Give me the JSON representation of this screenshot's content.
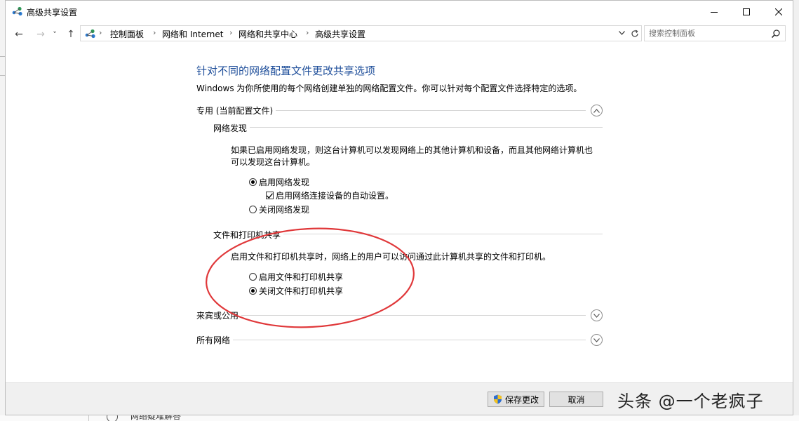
{
  "window": {
    "title": "高级共享设置"
  },
  "nav": {
    "back": "←",
    "forward": "→",
    "recent": "˅",
    "up": "↑"
  },
  "breadcrumb": [
    "控制面板",
    "网络和 Internet",
    "网络和共享中心",
    "高级共享设置"
  ],
  "search": {
    "placeholder": "搜索控制面板"
  },
  "main": {
    "heading": "针对不同的网络配置文件更改共享选项",
    "description": "Windows 为你所使用的每个网络创建单独的网络配置文件。你可以针对每个配置文件选择特定的选项。",
    "profiles": [
      {
        "label": "专用 (当前配置文件)",
        "expanded": true,
        "sections": [
          {
            "title": "网络发现",
            "text_line1": "如果已启用网络发现，则这台计算机可以发现网络上的其他计算机和设备，而且其他网络计算机也",
            "text_line2": "可以发现这台计算机。",
            "options": [
              {
                "label": "启用网络发现",
                "selected": true
              },
              {
                "label": "关闭网络发现",
                "selected": false
              }
            ],
            "checkbox": {
              "label": "启用网络连接设备的自动设置。",
              "checked": true
            }
          },
          {
            "title": "文件和打印机共享",
            "text": "启用文件和打印机共享时，网络上的用户可以访问通过此计算机共享的文件和打印机。",
            "options": [
              {
                "label": "启用文件和打印机共享",
                "selected": false
              },
              {
                "label": "关闭文件和打印机共享",
                "selected": true
              }
            ]
          }
        ]
      },
      {
        "label": "来宾或公用",
        "expanded": false
      },
      {
        "label": "所有网络",
        "expanded": false
      }
    ]
  },
  "footer": {
    "save_label": "保存更改",
    "cancel_label": "取消"
  },
  "annotation": {
    "color": "#e0383a"
  },
  "watermark": "头条 @一个老疯子",
  "behind": {
    "partial_text": "网络疑难解答"
  },
  "colors": {
    "heading": "#1e4e9a",
    "link_blue": "#1e4e9a"
  }
}
